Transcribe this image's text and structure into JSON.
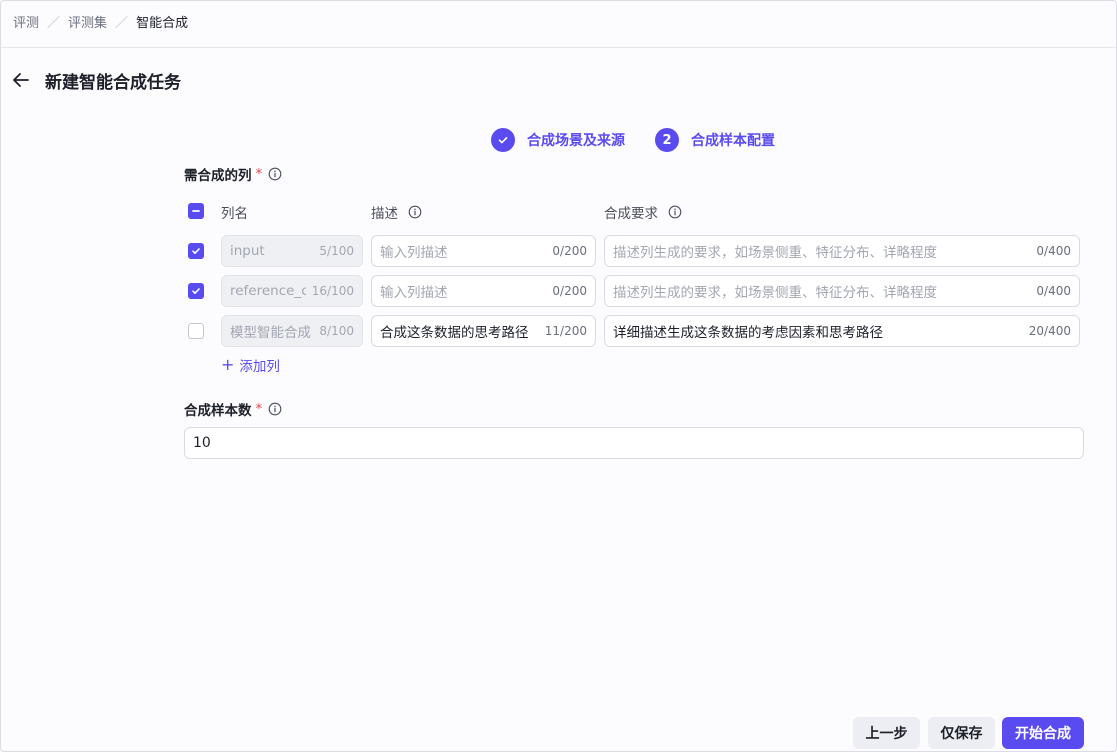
{
  "breadcrumb": {
    "items": [
      "评测",
      "评测集"
    ],
    "current": "智能合成",
    "separator": "／"
  },
  "page": {
    "title": "新建智能合成任务"
  },
  "steps": [
    {
      "label": "合成场景及来源",
      "status": "done"
    },
    {
      "label": "合成样本配置",
      "number": "2",
      "status": "active"
    }
  ],
  "columns_section": {
    "label": "需合成的列",
    "required_mark": "*",
    "headers": {
      "name": "列名",
      "description": "描述",
      "requirement": "合成要求"
    },
    "rows": [
      {
        "checked": true,
        "name": {
          "value": "input",
          "count": "5/100"
        },
        "description": {
          "value": "",
          "placeholder": "输入列描述",
          "count": "0/200"
        },
        "requirement": {
          "value": "",
          "placeholder": "描述列生成的要求，如场景侧重、特征分布、详略程度",
          "count": "0/400"
        }
      },
      {
        "checked": true,
        "name": {
          "value": "reference_c",
          "count": "16/100"
        },
        "description": {
          "value": "",
          "placeholder": "输入列描述",
          "count": "0/200"
        },
        "requirement": {
          "value": "",
          "placeholder": "描述列生成的要求，如场景侧重、特征分布、详略程度",
          "count": "0/400"
        }
      },
      {
        "checked": false,
        "name": {
          "value": "模型智能合成",
          "count": "8/100"
        },
        "description": {
          "value": "合成这条数据的思考路径",
          "placeholder": "",
          "count": "11/200"
        },
        "requirement": {
          "value": "详细描述生成这条数据的考虑因素和思考路径",
          "placeholder": "",
          "count": "20/400"
        }
      }
    ],
    "add_column_label": "添加列"
  },
  "sample_count": {
    "label": "合成样本数",
    "required_mark": "*",
    "value": "10"
  },
  "footer": {
    "prev_label": "上一步",
    "save_label": "仅保存",
    "start_label": "开始合成"
  },
  "colors": {
    "accent": "#5a4bf0",
    "required": "#e5484d"
  }
}
